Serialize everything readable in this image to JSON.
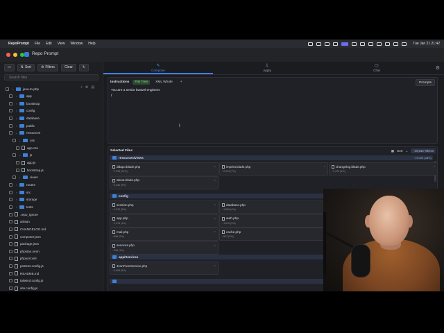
{
  "menubar": {
    "app": "RepoPrompt",
    "items": [
      "File",
      "Edit",
      "View",
      "Window",
      "Help"
    ],
    "clock": "Tue Jan 21  21:42"
  },
  "window": {
    "title": "Repo Prompt"
  },
  "left_toolbar": {
    "sort": "Sort",
    "filters": "Filters",
    "clear": "Clear"
  },
  "search": {
    "placeholder": "Search files"
  },
  "tree": [
    {
      "label": "java-to-php",
      "type": "folder",
      "depth": 0,
      "open": true
    },
    {
      "label": "app",
      "type": "folder",
      "depth": 1
    },
    {
      "label": "bootstrap",
      "type": "folder",
      "depth": 1
    },
    {
      "label": "config",
      "type": "folder",
      "depth": 1
    },
    {
      "label": "database",
      "type": "folder",
      "depth": 1
    },
    {
      "label": "public",
      "type": "folder",
      "depth": 1
    },
    {
      "label": "resources",
      "type": "folder",
      "depth": 1,
      "open": true
    },
    {
      "label": "css",
      "type": "folder",
      "depth": 2,
      "open": true
    },
    {
      "label": "app.css",
      "type": "file",
      "depth": 3
    },
    {
      "label": "js",
      "type": "folder",
      "depth": 2,
      "open": true
    },
    {
      "label": "app.js",
      "type": "file",
      "depth": 3
    },
    {
      "label": "bootstrap.js",
      "type": "file",
      "depth": 3
    },
    {
      "label": "views",
      "type": "folder",
      "depth": 2
    },
    {
      "label": "routes",
      "type": "folder",
      "depth": 1
    },
    {
      "label": "src",
      "type": "folder",
      "depth": 1
    },
    {
      "label": "storage",
      "type": "folder",
      "depth": 1
    },
    {
      "label": "tests",
      "type": "folder",
      "depth": 1
    },
    {
      "label": ".repo_ignore",
      "type": "file",
      "depth": 1
    },
    {
      "label": "artisan",
      "type": "file",
      "depth": 1
    },
    {
      "label": "CHANGELOG.md",
      "type": "file",
      "depth": 1
    },
    {
      "label": "composer.json",
      "type": "file",
      "depth": 1
    },
    {
      "label": "package.json",
      "type": "file",
      "depth": 1
    },
    {
      "label": "phpstan.neon",
      "type": "file",
      "depth": 1
    },
    {
      "label": "phpunit.xml",
      "type": "file",
      "depth": 1
    },
    {
      "label": "postcss.config.js",
      "type": "file",
      "depth": 1
    },
    {
      "label": "README.md",
      "type": "file",
      "depth": 1
    },
    {
      "label": "tailwind.config.js",
      "type": "file",
      "depth": 1
    },
    {
      "label": "vite.config.js",
      "type": "file",
      "depth": 1
    }
  ],
  "tabs": [
    {
      "label": "Compose",
      "active": true
    },
    {
      "label": "Apply",
      "active": false
    },
    {
      "label": "Chat",
      "active": false
    }
  ],
  "instructions": {
    "label": "Instructions",
    "file_tree": "File Tree",
    "xml_whole": "XML Whole",
    "add": "+",
    "prompts": "Prompts",
    "text": "You are a senior laravel engineer.",
    "caret": "/"
  },
  "selected": {
    "title": "Selected Files",
    "sort": "Sort",
    "tokens": "~39,816 Tokens",
    "groups": [
      {
        "name": "resources/views",
        "tokens": "~19,000 (48%)",
        "files": [
          {
            "name": "ddapo.blade.php",
            "tokens": "~7,395 (21%)"
          },
          {
            "name": "imprint.blade.php",
            "tokens": "~2,919 (7%)"
          },
          {
            "name": "changelog.blade.php",
            "tokens": "~3,474 (9%)"
          },
          {
            "name": "about.blade.php",
            "tokens": "~3,456 (9%)"
          }
        ]
      },
      {
        "name": "config",
        "tokens": "",
        "files": [
          {
            "name": "session.php",
            "tokens": "~1,876 (5%)"
          },
          {
            "name": "database.php",
            "tokens": "~1,506 (4%)"
          },
          {
            "name": "app.php",
            "tokens": "~1,476 (4%)"
          },
          {
            "name": "auth.php",
            "tokens": "~1,010 (3%)"
          },
          {
            "name": "mail.php",
            "tokens": "~896 (2%)"
          },
          {
            "name": "cache.php",
            "tokens": "~917 (2%)"
          },
          {
            "name": "services.php",
            "tokens": "~336 (1%)"
          }
        ]
      },
      {
        "name": "app/Services",
        "tokens": "",
        "files": [
          {
            "name": "JsonFixerService.php",
            "tokens": "~2,063 (5%)"
          }
        ]
      },
      {
        "name": "",
        "tokens": "",
        "files": []
      }
    ]
  }
}
